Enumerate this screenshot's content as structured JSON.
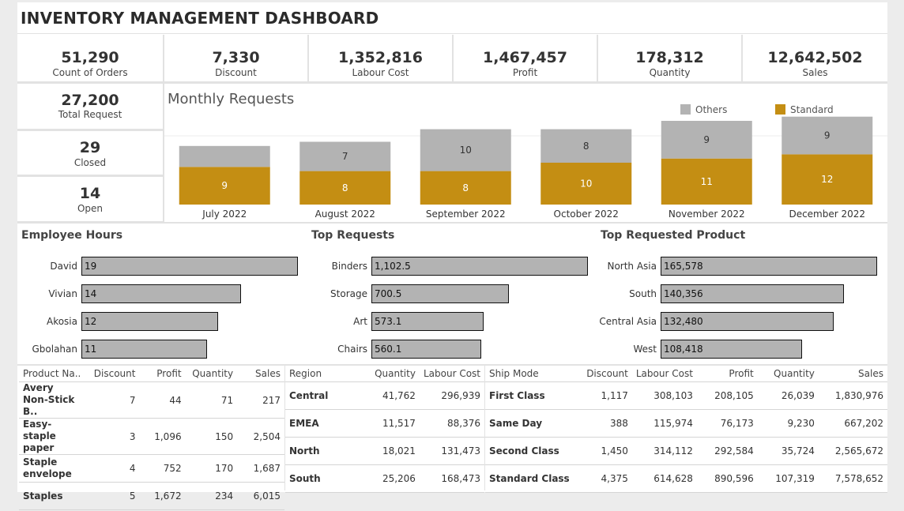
{
  "title": "INVENTORY MANAGEMENT DASHBOARD",
  "kpis": [
    {
      "value": "51,290",
      "label": "Count of Orders"
    },
    {
      "value": "7,330",
      "label": "Discount"
    },
    {
      "value": "1,352,816",
      "label": "Labour Cost"
    },
    {
      "value": "1,467,457",
      "label": "Profit"
    },
    {
      "value": "178,312",
      "label": "Quantity"
    },
    {
      "value": "12,642,502",
      "label": "Sales"
    }
  ],
  "side_kpis": [
    {
      "value": "27,200",
      "label": "Total Request"
    },
    {
      "value": "29",
      "label": "Closed"
    },
    {
      "value": "14",
      "label": "Open"
    }
  ],
  "colors": {
    "others": "#b3b3b3",
    "standard": "#c48e13"
  },
  "chart_data": {
    "type": "bar",
    "stacked": true,
    "title": "Monthly Requests",
    "categories": [
      "July 2022",
      "August 2022",
      "September 2022",
      "October 2022",
      "November 2022",
      "December 2022"
    ],
    "series": [
      {
        "name": "Standard",
        "values": [
          9,
          8,
          8,
          10,
          11,
          12
        ]
      },
      {
        "name": "Others",
        "values": [
          5,
          7,
          10,
          8,
          9,
          9
        ]
      }
    ],
    "series_labels": [
      [
        "9",
        "8",
        "8",
        "10",
        "11",
        "12"
      ],
      [
        "",
        "7",
        "10",
        "8",
        "9",
        "9"
      ]
    ],
    "legend": "top-right",
    "grid": false
  },
  "employee_hours": {
    "title": "Employee Hours",
    "items": [
      {
        "name": "David",
        "value": 19,
        "label": "19"
      },
      {
        "name": "Vivian",
        "value": 14,
        "label": "14"
      },
      {
        "name": "Akosia",
        "value": 12,
        "label": "12"
      },
      {
        "name": "Gbolahan",
        "value": 11,
        "label": "11"
      }
    ]
  },
  "top_requests": {
    "title": "Top Requests",
    "items": [
      {
        "name": "Binders",
        "value": 1102.5,
        "label": "1,102.5"
      },
      {
        "name": "Storage",
        "value": 700.5,
        "label": "700.5"
      },
      {
        "name": "Art",
        "value": 573.1,
        "label": "573.1"
      },
      {
        "name": "Chairs",
        "value": 560.1,
        "label": "560.1"
      }
    ]
  },
  "top_product": {
    "title": "Top Requested Product",
    "items": [
      {
        "name": "North Asia",
        "value": 165578,
        "label": "165,578"
      },
      {
        "name": "South",
        "value": 140356,
        "label": "140,356"
      },
      {
        "name": "Central Asia",
        "value": 132480,
        "label": "132,480"
      },
      {
        "name": "West",
        "value": 108418,
        "label": "108,418"
      }
    ]
  },
  "product_table": {
    "headers": [
      "Product Na..",
      "Discount",
      "Profit",
      "Quantity",
      "Sales"
    ],
    "rows": [
      [
        "Avery Non-Stick B..",
        "7",
        "44",
        "71",
        "217"
      ],
      [
        "Easy-staple paper",
        "3",
        "1,096",
        "150",
        "2,504"
      ],
      [
        "Staple envelope",
        "4",
        "752",
        "170",
        "1,687"
      ],
      [
        "Staples",
        "5",
        "1,672",
        "234",
        "6,015"
      ]
    ]
  },
  "region_table": {
    "headers": [
      "Region",
      "Quantity",
      "Labour Cost"
    ],
    "rows": [
      [
        "Central",
        "41,762",
        "296,939"
      ],
      [
        "EMEA",
        "11,517",
        "88,376"
      ],
      [
        "North",
        "18,021",
        "131,473"
      ],
      [
        "South",
        "25,206",
        "168,473"
      ]
    ]
  },
  "ship_table": {
    "headers": [
      "Ship Mode",
      "Discount",
      "Labour Cost",
      "Profit",
      "Quantity",
      "Sales"
    ],
    "rows": [
      [
        "First Class",
        "1,117",
        "308,103",
        "208,105",
        "26,039",
        "1,830,976"
      ],
      [
        "Same Day",
        "388",
        "115,974",
        "76,173",
        "9,230",
        "667,202"
      ],
      [
        "Second Class",
        "1,450",
        "314,112",
        "292,584",
        "35,724",
        "2,565,672"
      ],
      [
        "Standard Class",
        "4,375",
        "614,628",
        "890,596",
        "107,319",
        "7,578,652"
      ]
    ]
  }
}
